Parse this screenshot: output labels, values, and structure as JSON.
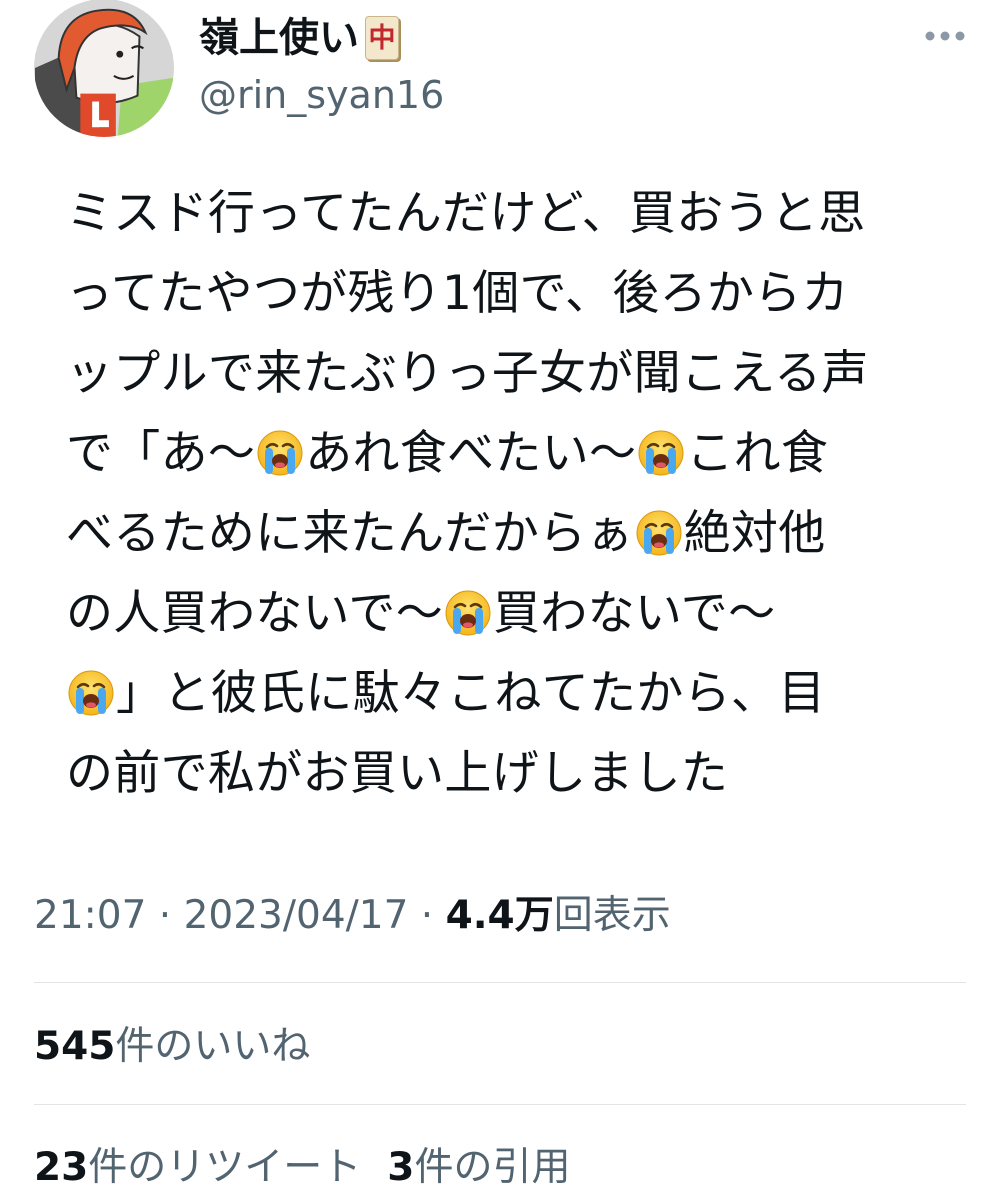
{
  "profile": {
    "display_name": "嶺上使い",
    "name_badge": "中",
    "handle": "@rin_syan16",
    "avatar_icon": "cartoon-avatar-icon"
  },
  "tweet": {
    "lines": [
      [
        "ミスド行ってたんだけど、買おうと思"
      ],
      [
        "ってたやつが残り1個で、後ろからカ"
      ],
      [
        "ップルで来たぶりっ子女が聞こえる声"
      ],
      [
        "で「あ〜",
        "😭",
        "あれ食べたい〜",
        "😭",
        "これ食"
      ],
      [
        "べるために来たんだからぁ",
        "😭",
        "絶対他"
      ],
      [
        "の人買わないで〜",
        "😭",
        "買わないで〜"
      ],
      [
        "😭",
        "」と彼氏に駄々こねてたから、目"
      ],
      [
        "の前で私がお買い上げしました"
      ]
    ]
  },
  "meta": {
    "time": "21:07",
    "separator": " · ",
    "date": "2023/04/17",
    "views_count": "4.4万",
    "views_label": "回表示"
  },
  "stats": {
    "likes_count": "545",
    "likes_label": "件のいいね",
    "retweets_count": "23",
    "retweets_label": "件のリツイート",
    "quotes_count": "3",
    "quotes_label": "件の引用"
  },
  "colors": {
    "text": "#0f1419",
    "secondary": "#536471",
    "divider": "#e1e5e8",
    "badge_red": "#c1272d"
  }
}
